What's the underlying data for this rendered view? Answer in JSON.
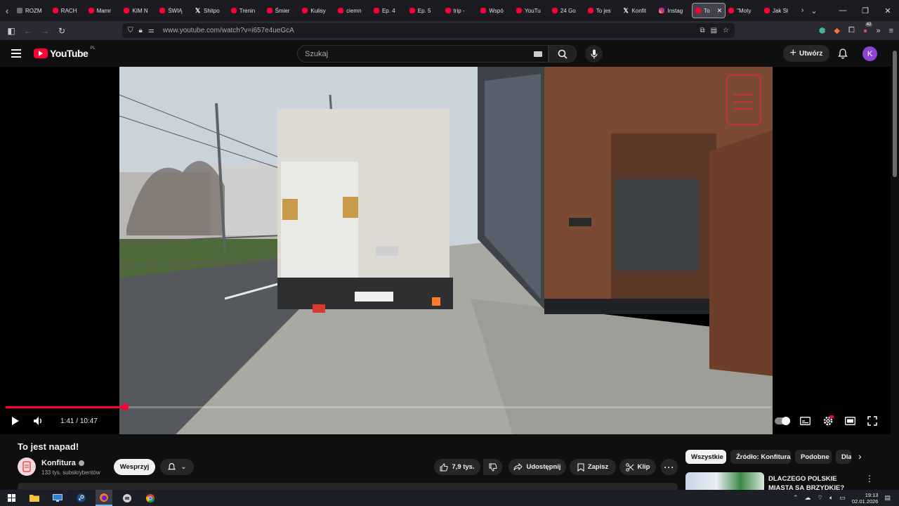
{
  "browser": {
    "tabs": [
      {
        "label": "ROZM",
        "icon": "page-icon"
      },
      {
        "label": "RACH",
        "icon": "youtube-icon"
      },
      {
        "label": "Mamr",
        "icon": "youtube-icon"
      },
      {
        "label": "KIM N",
        "icon": "youtube-icon"
      },
      {
        "label": "ŚWIĄ",
        "icon": "youtube-icon"
      },
      {
        "label": "Shitpo",
        "icon": "x-icon"
      },
      {
        "label": "Trenin",
        "icon": "youtube-icon"
      },
      {
        "label": "Śmier",
        "icon": "youtube-icon"
      },
      {
        "label": "Kulisy",
        "icon": "youtube-icon"
      },
      {
        "label": "ciemn",
        "icon": "youtube-icon"
      },
      {
        "label": "Ep. 4",
        "icon": "youtube-icon"
      },
      {
        "label": "Ep. 5",
        "icon": "youtube-icon"
      },
      {
        "label": "trip -",
        "icon": "youtube-icon"
      },
      {
        "label": "Wspó",
        "icon": "youtube-icon"
      },
      {
        "label": "YouTu",
        "icon": "youtube-icon"
      },
      {
        "label": "24 Go",
        "icon": "youtube-icon"
      },
      {
        "label": "To jes",
        "icon": "youtube-icon"
      },
      {
        "label": "Konfit",
        "icon": "x-icon"
      },
      {
        "label": "Instag",
        "icon": "instagram-icon"
      },
      {
        "label": "To",
        "icon": "youtube-icon",
        "active": true
      },
      {
        "label": "\"Moty",
        "icon": "youtube-icon"
      },
      {
        "label": "Jak Sł",
        "icon": "youtube-icon"
      }
    ],
    "url": "www.youtube.com/watch?v=i657e4ueGcA",
    "extension_badge": "42"
  },
  "youtube": {
    "logo_text": "YouTube",
    "region": "PL",
    "search_placeholder": "Szukaj",
    "create_label": "Utwórz",
    "avatar_letter": "K"
  },
  "player": {
    "current_time": "1:41",
    "duration": "10:47",
    "progress_fraction": 0.156
  },
  "video": {
    "title": "To jest napad!",
    "channel": "Konfitura",
    "subscribers": "133 tys. subskrybentów",
    "support_label": "Wesprzyj",
    "likes": "7,9 tys.",
    "share_label": "Udostępnij",
    "save_label": "Zapisz",
    "clip_label": "Klip"
  },
  "sidebar": {
    "chips": [
      "Wszystkie",
      "Źródło: Konfitura",
      "Podobne",
      "Dla"
    ],
    "recommendation_title": "DLACZEGO POLSKIE MIASTA SĄ BRZYDKIE?"
  },
  "taskbar": {
    "time": "19:13",
    "date": "02.01.2026"
  },
  "colors": {
    "accent": "#ff0033",
    "background": "#0f0f0f"
  }
}
